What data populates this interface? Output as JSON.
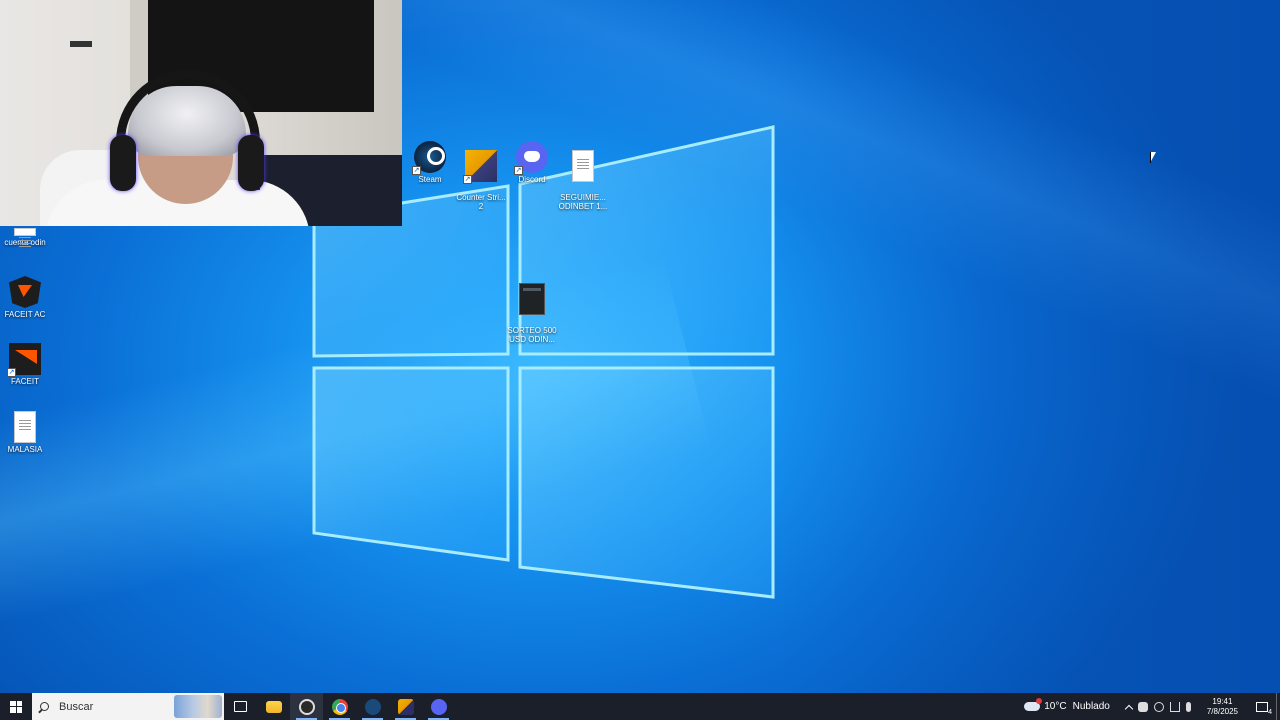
{
  "desktop": {
    "icons_top": [
      {
        "label": "Steam",
        "icon": "steam-icon"
      },
      {
        "label": "Counter Stri...\n2",
        "icon": "counter-strike-icon"
      },
      {
        "label": "Discord",
        "icon": "discord-icon"
      },
      {
        "label": "SEGUIMIE...\nODINBET 1...",
        "icon": "document-icon"
      }
    ],
    "icon_sorteo": {
      "label": "SORTEO 500\nUSD ODIN...",
      "icon": "executable-icon"
    },
    "icons_left": [
      {
        "label": "cuenta odin",
        "icon": "document-icon"
      },
      {
        "label": "FACEIT AC",
        "icon": "faceit-ac-icon"
      },
      {
        "label": "FACEIT",
        "icon": "faceit-icon"
      },
      {
        "label": "MALASIA",
        "icon": "document-icon"
      }
    ]
  },
  "taskbar": {
    "search_placeholder": "Buscar",
    "apps": [
      "task-view-icon",
      "file-explorer-icon",
      "obs-icon",
      "chrome-icon",
      "steam-icon",
      "counter-strike-icon",
      "discord-icon"
    ],
    "weather": {
      "temp": "10°C",
      "condition": "Nublado"
    },
    "clock": {
      "time": "19:41",
      "date": "7/8/2025"
    },
    "notification_count": "4"
  },
  "colors": {
    "taskbar": "#1b1f2a",
    "wallpaper_accent": "#1590ee"
  }
}
